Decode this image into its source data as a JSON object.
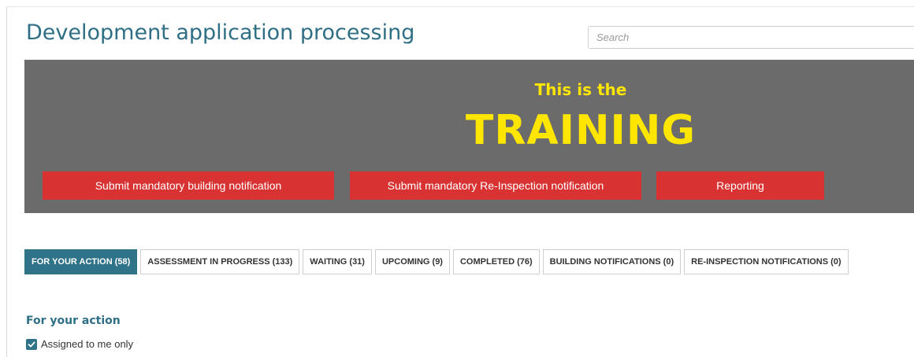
{
  "page": {
    "title": "Development application processing"
  },
  "search": {
    "placeholder": "Search",
    "value": ""
  },
  "banner": {
    "line1": "This is the",
    "line2": "TRAINING",
    "background_color": "#6b6b6b",
    "text_color": "#ffe600",
    "buttons": [
      {
        "label": "Submit mandatory building notification",
        "color": "#d83232"
      },
      {
        "label": "Submit mandatory Re-Inspection notification",
        "color": "#d83232"
      },
      {
        "label": "Reporting",
        "color": "#d83232"
      }
    ]
  },
  "tabs": [
    {
      "label": "FOR YOUR ACTION (58)",
      "active": true
    },
    {
      "label": "ASSESSMENT IN PROGRESS (133)",
      "active": false
    },
    {
      "label": "WAITING (31)",
      "active": false
    },
    {
      "label": "UPCOMING (9)",
      "active": false
    },
    {
      "label": "COMPLETED (76)",
      "active": false
    },
    {
      "label": "BUILDING NOTIFICATIONS (0)",
      "active": false
    },
    {
      "label": "RE-INSPECTION NOTIFICATIONS (0)",
      "active": false
    }
  ],
  "section": {
    "heading": "For your action",
    "checkbox": {
      "label": "Assigned to me only",
      "checked": true,
      "icon": "checkmark-icon"
    }
  },
  "colors": {
    "accent": "#2f7389",
    "title": "#2f6f85"
  }
}
